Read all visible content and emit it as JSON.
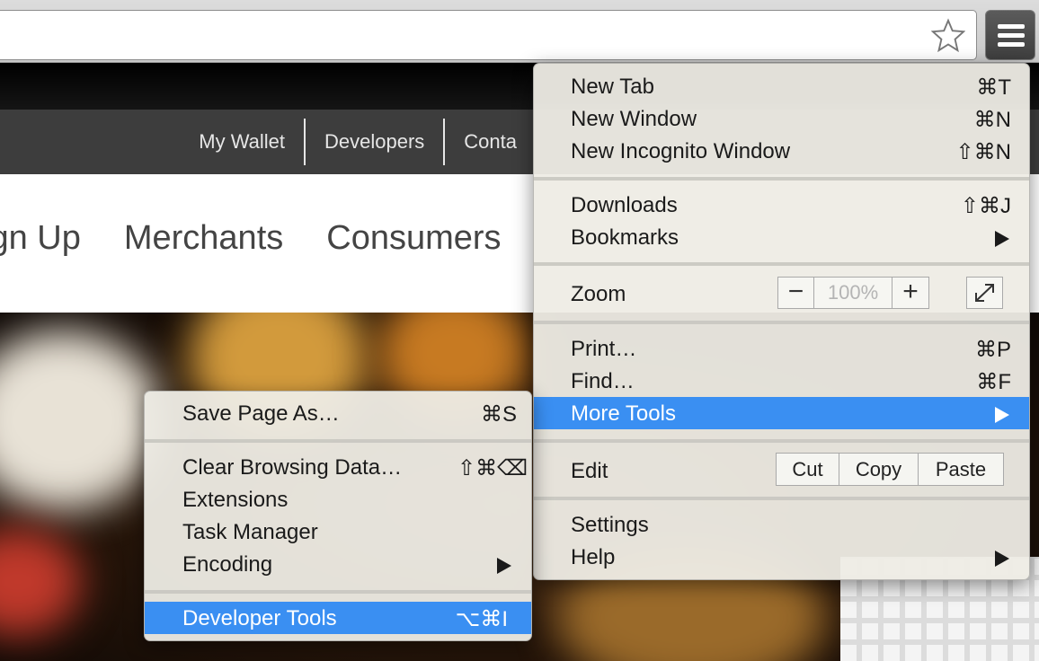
{
  "browser": {
    "bookmark_icon": "star-icon",
    "menu_icon": "hamburger-menu-icon"
  },
  "site": {
    "top_links": [
      "My Wallet",
      "Developers",
      "Conta"
    ],
    "main_nav": [
      "ign Up",
      "Merchants",
      "Consumers"
    ]
  },
  "main_menu": {
    "new_tab": {
      "label": "New Tab",
      "shortcut": "⌘T"
    },
    "new_window": {
      "label": "New Window",
      "shortcut": "⌘N"
    },
    "new_incognito": {
      "label": "New Incognito Window",
      "shortcut": "⇧⌘N"
    },
    "downloads": {
      "label": "Downloads",
      "shortcut": "⇧⌘J"
    },
    "bookmarks": {
      "label": "Bookmarks"
    },
    "zoom": {
      "label": "Zoom",
      "minus": "−",
      "value": "100%",
      "plus": "+"
    },
    "print": {
      "label": "Print…",
      "shortcut": "⌘P"
    },
    "find": {
      "label": "Find…",
      "shortcut": "⌘F"
    },
    "more_tools": {
      "label": "More Tools"
    },
    "edit": {
      "label": "Edit",
      "cut": "Cut",
      "copy": "Copy",
      "paste": "Paste"
    },
    "settings": {
      "label": "Settings"
    },
    "help": {
      "label": "Help"
    }
  },
  "sub_menu": {
    "save_page": {
      "label": "Save Page As…",
      "shortcut": "⌘S"
    },
    "clear_data": {
      "label": "Clear Browsing Data…",
      "shortcut": "⇧⌘⌫"
    },
    "extensions": {
      "label": "Extensions"
    },
    "task_manager": {
      "label": "Task Manager"
    },
    "encoding": {
      "label": "Encoding"
    },
    "developer_tools": {
      "label": "Developer Tools",
      "shortcut": "⌥⌘I"
    }
  },
  "colors": {
    "highlight": "#3a8ff2",
    "nav_bar": "#3d3d3d"
  }
}
